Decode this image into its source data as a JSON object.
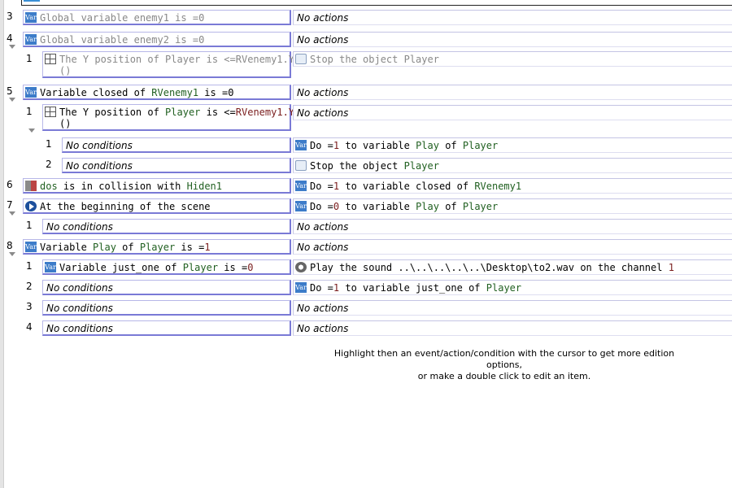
{
  "rows": [
    {
      "number": "3",
      "condition": "Global variable enemy1 is =0",
      "action": "No actions"
    },
    {
      "number": "4",
      "condition": "Global variable enemy2 is =0",
      "action": "No actions"
    },
    {
      "number": "1",
      "condition_parts": [
        "The Y position of Player is <=RVenemy1.Y",
        "()"
      ],
      "action": "Stop the object Player"
    },
    {
      "number": "5",
      "condition_parts": [
        "Variable closed of ",
        "RVenemy1",
        " is =0"
      ],
      "action": "No actions"
    },
    {
      "number": "1",
      "condition_parts": [
        "The Y position of ",
        "Player",
        " is <=",
        "RVenemy1.Y",
        "()"
      ],
      "action": "No actions"
    },
    {
      "number": "1",
      "condition": "No conditions",
      "action_parts": [
        "Do =",
        "1",
        " to variable ",
        "Play",
        " of ",
        "Player"
      ]
    },
    {
      "number": "2",
      "condition": "No conditions",
      "action_parts": [
        "Stop the object ",
        "Player"
      ]
    },
    {
      "number": "6",
      "condition_parts": [
        "dos",
        " is in collision with ",
        "Hiden1"
      ],
      "action_parts": [
        "Do =",
        "1",
        " to variable closed of ",
        "RVenemy1"
      ]
    },
    {
      "number": "7",
      "condition": "At the beginning of the scene",
      "action_parts": [
        "Do =",
        "0",
        " to variable ",
        "Play",
        " of ",
        "Player"
      ]
    },
    {
      "number": "1",
      "condition": "No conditions",
      "action": "No actions"
    },
    {
      "number": "8",
      "condition_parts": [
        "Variable ",
        "Play",
        " of ",
        "Player",
        " is =",
        "1"
      ],
      "action": "No actions"
    },
    {
      "number": "1",
      "condition_parts": [
        "Variable just_one of ",
        "Player",
        " is =",
        "0"
      ],
      "action_parts": [
        "Play the sound ..\\..\\..\\..\\..\\Desktop\\to2.wav on the channel ",
        "1"
      ]
    },
    {
      "number": "2",
      "condition": "No conditions",
      "action_parts": [
        "Do =",
        "1",
        " to variable just_one of ",
        "Player"
      ]
    },
    {
      "number": "3",
      "condition": "No conditions",
      "action": "No actions"
    },
    {
      "number": "4",
      "condition": "No conditions",
      "action": "No actions"
    }
  ],
  "help_text": {
    "line1": "Highlight then an event/action/condition with the cursor to get more edition options,",
    "line2": "or make a double click to edit an item."
  },
  "icons": {
    "var": "Var"
  }
}
